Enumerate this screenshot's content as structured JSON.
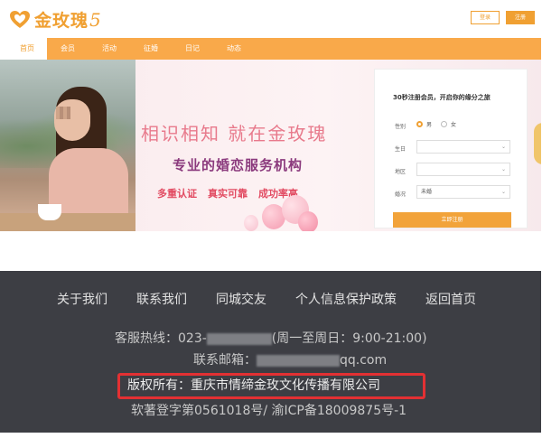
{
  "header": {
    "logo_text": "金玫瑰",
    "logo_swirl": "5",
    "login_label": "登录",
    "register_label": "注册"
  },
  "nav": [
    {
      "label": "首页",
      "active": true
    },
    {
      "label": "会员"
    },
    {
      "label": "活动"
    },
    {
      "label": "征婚"
    },
    {
      "label": "日记"
    },
    {
      "label": "动态"
    }
  ],
  "banner": {
    "slogan_main": "相识相知 就在金玫瑰",
    "slogan_sub": "专业的婚恋服务机构",
    "features": [
      "多重认证",
      "真实可靠",
      "成功率高"
    ]
  },
  "register_card": {
    "title": "30秒注册会员，开启你的缘分之旅",
    "gender_label": "性别",
    "male_label": "男",
    "female_label": "女",
    "birthday_label": "生日",
    "region_label": "地区",
    "marital_label": "婚况",
    "marital_value": "未婚",
    "submit_label": "立即注册"
  },
  "footer": {
    "links": [
      "关于我们",
      "联系我们",
      "同城交友",
      "个人信息保护政策",
      "返回首页"
    ],
    "hotline_prefix": "客服热线：023-",
    "hotline_suffix": "(周一至周日：9:00-21:00)",
    "email_prefix": "联系邮箱：",
    "email_suffix": "qq.com",
    "copyright": "版权所有：重庆市情缔金玫文化传播有限公司",
    "registration": "软著登字第0561018号/ 渝ICP备18009875号-1"
  },
  "colors": {
    "brand_orange": "#f0a032",
    "nav_bg": "#f9a94a",
    "footer_bg": "#3d3e44",
    "highlight_red": "#e33033"
  }
}
